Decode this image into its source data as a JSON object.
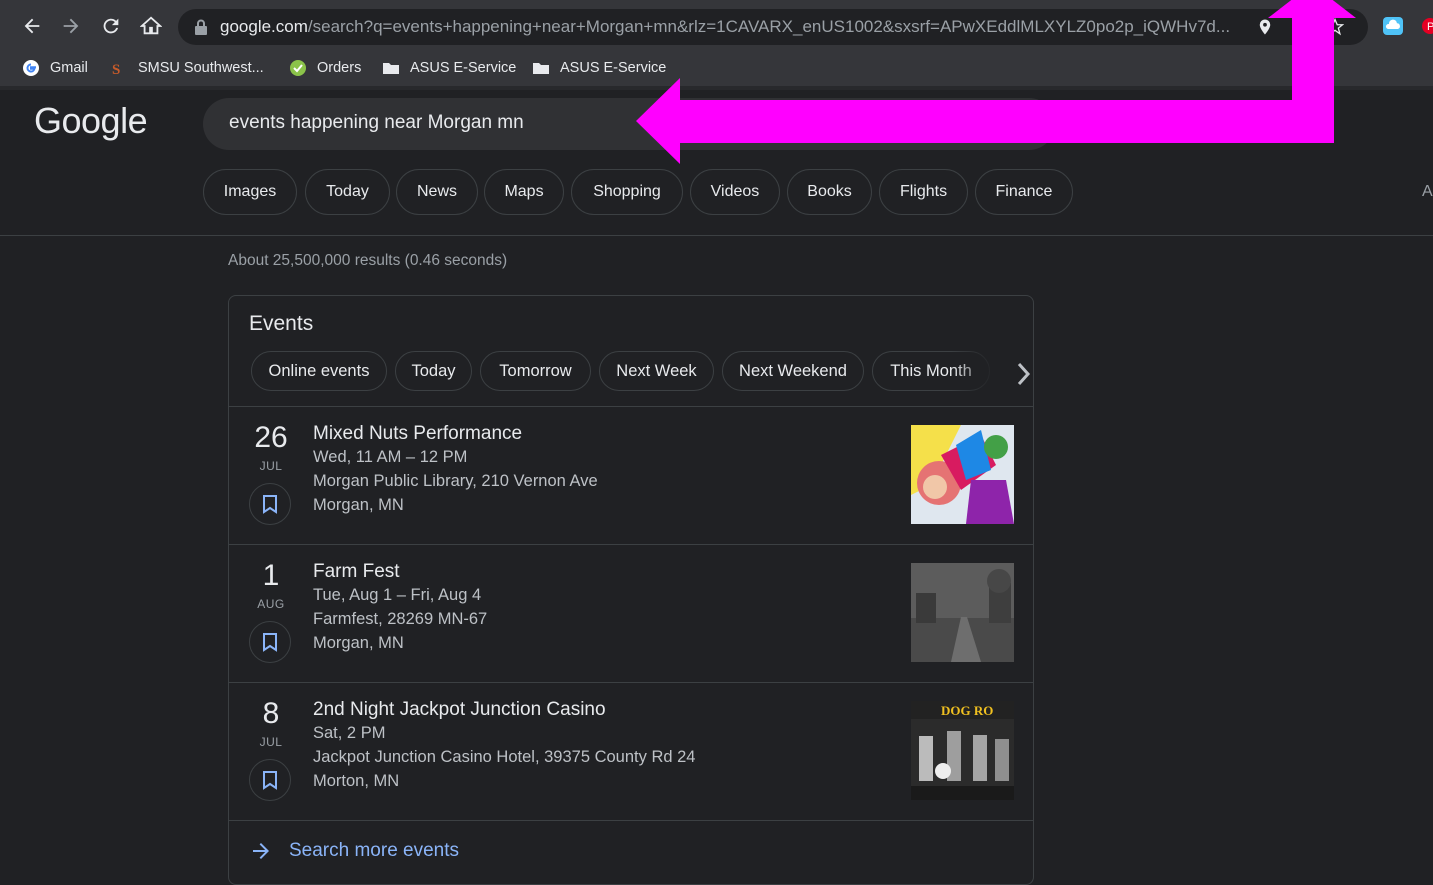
{
  "browser": {
    "url_host": "google.com",
    "url_path": "/search?q=events+happening+near+Morgan+mn&rlz=1CAVARX_enUS1002&sxsrf=APwXEddlMLXYLZ0po2p_iQWHv7d...",
    "bookmarks": [
      {
        "label": "Gmail",
        "icon": "google-icon"
      },
      {
        "label": "SMSU  Southwest...",
        "icon": "smsu-icon"
      },
      {
        "label": "Orders",
        "icon": "orders-icon"
      },
      {
        "label": "ASUS E-Service",
        "icon": "folder-icon"
      },
      {
        "label": "ASUS E-Service",
        "icon": "folder-icon"
      }
    ]
  },
  "google": {
    "logo": "Google",
    "query": "events happening near Morgan mn",
    "chips": [
      "Images",
      "Today",
      "News",
      "Maps",
      "Shopping",
      "Videos",
      "Books",
      "Flights",
      "Finance"
    ],
    "chip_overflow": "A",
    "result_stats": "About 25,500,000 results (0.46 seconds)"
  },
  "events": {
    "title": "Events",
    "filters": [
      "Online events",
      "Today",
      "Tomorrow",
      "Next Week",
      "Next Weekend",
      "This Month"
    ],
    "items": [
      {
        "day": "26",
        "month": "JUL",
        "name": "Mixed Nuts Performance",
        "time": "Wed, 11 AM – 12 PM",
        "venue": "Morgan Public Library, 210 Vernon Ave",
        "city": "Morgan, MN"
      },
      {
        "day": "1",
        "month": "AUG",
        "name": "Farm Fest",
        "time": "Tue, Aug 1 – Fri, Aug 4",
        "venue": "Farmfest, 28269 MN-67",
        "city": "Morgan, MN"
      },
      {
        "day": "8",
        "month": "JUL",
        "name": "2nd Night Jackpot Junction Casino",
        "time": "Sat, 2 PM",
        "venue": "Jackpot Junction Casino Hotel, 39375 County Rd 24",
        "city": "Morton, MN"
      }
    ],
    "poster_text": "DOG RO",
    "more_label": "Search more events"
  },
  "colors": {
    "annotation": "#ff00ff",
    "link": "#8ab4f8"
  }
}
